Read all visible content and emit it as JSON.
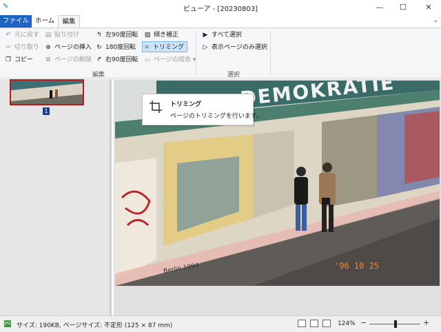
{
  "window": {
    "title": "ビューア - [20230803]",
    "min": "—",
    "max": "☐",
    "close": "✕"
  },
  "tabs": [
    {
      "label": "ファイル"
    },
    {
      "label": "ホーム"
    },
    {
      "label": "編集"
    }
  ],
  "ribbon": {
    "edit_group": {
      "label": "編集",
      "undo": "元に戻す",
      "paste": "貼り付け",
      "cut": "切り取り",
      "insert_page": "ページの挿入",
      "copy": "コピー",
      "delete_page": "ページの削除",
      "rotate_left": "左90度回転",
      "rotate_180": "180度回転",
      "rotate_right": "右90度回転",
      "deskew": "傾き補正",
      "trim": "トリミング",
      "merge_pages": "ページの結合"
    },
    "select_group": {
      "label": "選択",
      "select_all": "すべて選択",
      "select_visible": "表示ページのみ選択"
    }
  },
  "thumbnail": {
    "page_number": "1"
  },
  "photo": {
    "wall_text": "DEMOKRATIE",
    "graffiti_text": "Berlin 1994",
    "date_stamp": "'96 10 25"
  },
  "tooltip": {
    "title": "トリミング",
    "description": "ページのトリミングを行います。"
  },
  "status": {
    "file_badge": "JPG",
    "info": "サイズ: 190KB, ページサイズ: 不定形 (125 × 87 mm)",
    "zoom": "124%",
    "zoom_minus": "−",
    "zoom_plus": "+"
  }
}
